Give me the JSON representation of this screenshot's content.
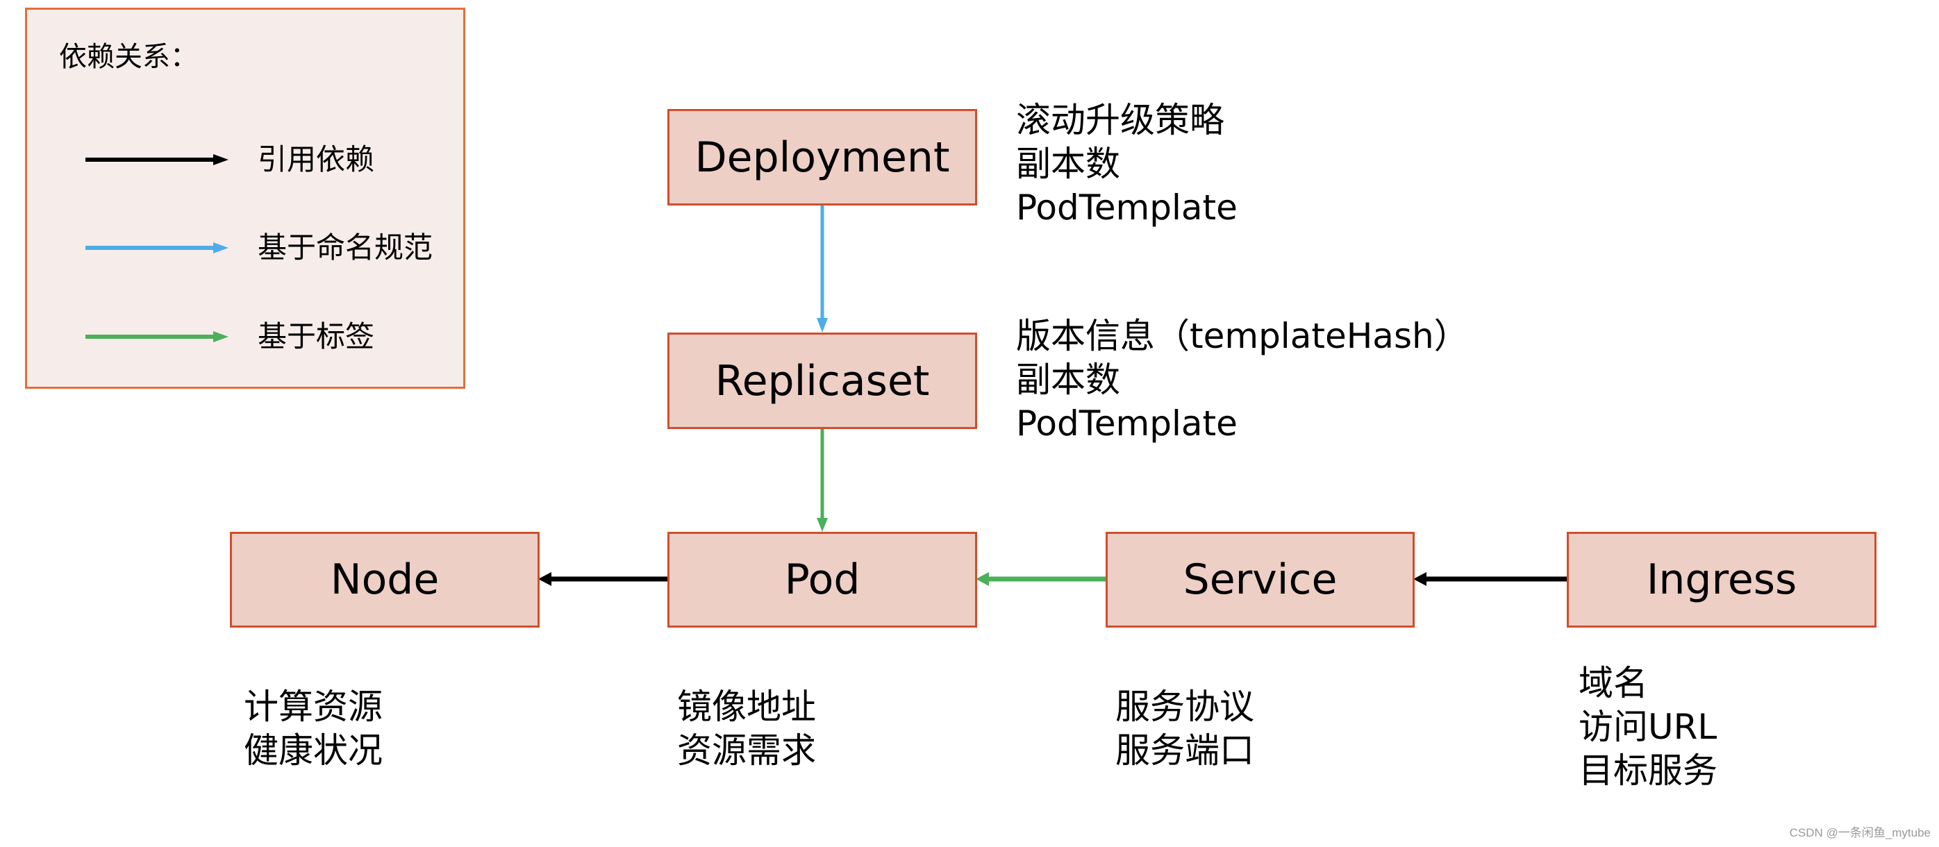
{
  "legend": {
    "title": "依赖关系：",
    "items": [
      {
        "label": "引用依赖",
        "color": "#000000",
        "kind": "reference"
      },
      {
        "label": "基于命名规范",
        "color": "#4DADE8",
        "kind": "naming-convention"
      },
      {
        "label": "基于标签",
        "color": "#4CAF5A",
        "kind": "label-selector"
      }
    ]
  },
  "colors": {
    "node_fill": "#EDCFC6",
    "node_border": "#D14E2C",
    "legend_fill": "#F6EDEB",
    "legend_border": "#E07038"
  },
  "nodes": {
    "deployment": {
      "label": "Deployment",
      "notes": [
        "滚动升级策略",
        "副本数",
        "PodTemplate"
      ]
    },
    "replicaset": {
      "label": "Replicaset",
      "notes": [
        "版本信息（templateHash）",
        "副本数",
        "PodTemplate"
      ]
    },
    "pod": {
      "label": "Pod",
      "notes": [
        "镜像地址",
        "资源需求"
      ]
    },
    "node": {
      "label": "Node",
      "notes": [
        "计算资源",
        "健康状况"
      ]
    },
    "service": {
      "label": "Service",
      "notes": [
        "服务协议",
        "服务端口"
      ]
    },
    "ingress": {
      "label": "Ingress",
      "notes": [
        "域名",
        "访问URL",
        "目标服务"
      ]
    }
  },
  "edges": [
    {
      "from": "deployment",
      "to": "replicaset",
      "type": "naming-convention"
    },
    {
      "from": "replicaset",
      "to": "pod",
      "type": "label-selector"
    },
    {
      "from": "pod",
      "to": "node",
      "type": "reference"
    },
    {
      "from": "service",
      "to": "pod",
      "type": "label-selector"
    },
    {
      "from": "ingress",
      "to": "service",
      "type": "reference"
    }
  ],
  "watermark": "CSDN @一条闲鱼_mytube"
}
